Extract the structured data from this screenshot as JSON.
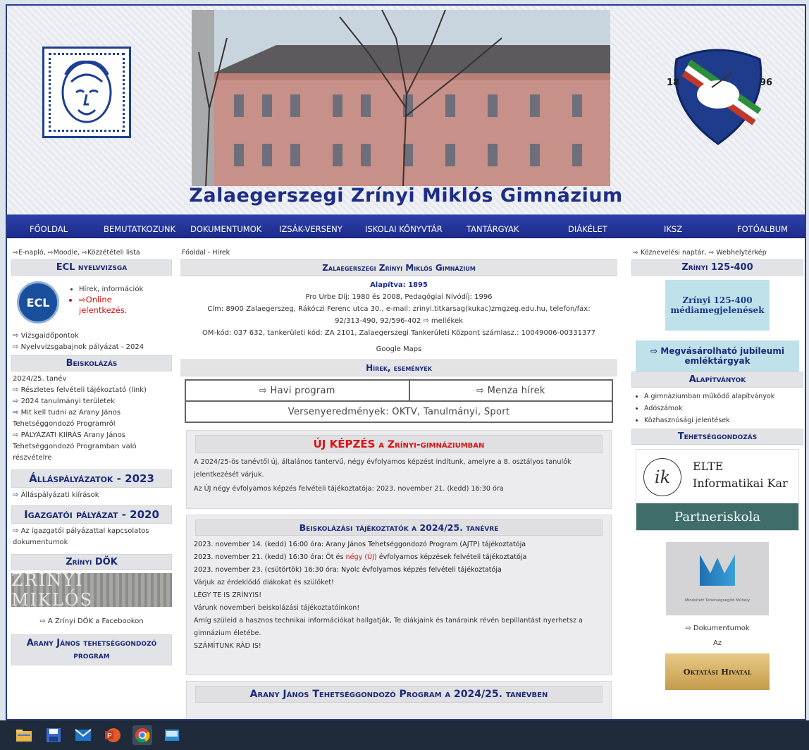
{
  "header": {
    "title": "Zalaegerszegi Zrínyi Miklós Gimnázium",
    "crest_years": [
      "18",
      "96"
    ]
  },
  "nav": {
    "items": [
      "Főoldal",
      "Bemutatkozunk",
      "Dokumentumok",
      "Izsák-verseny",
      "Iskolai könyvtár",
      "Tantárgyak",
      "Diákélet",
      "IKSZ",
      "Fotóalbum"
    ]
  },
  "left": {
    "toplinks": "⇨E-napló, ⇨Moodle, ⇨Közzétételi lista",
    "ecl_title": "ECL nyelvvizsga",
    "ecl_links": [
      "Hírek, információk",
      "⇨Online jelentkezés."
    ],
    "ecl_more": [
      "Vizsgaidőpontok",
      "Nyelvvizsgabajnok pályázat - 2024"
    ],
    "beiskolazas_title": "Beiskolázás",
    "tanev": "2024/25. tanév",
    "beiskolazas_links": [
      "Részletes felvételi tájékoztató (link)",
      "2024 tanulmányi területek",
      "Mit kell tudni az Arany János Tehetséggondozó Programról",
      "PÁLYÁZATI KIÍRÁS Arany János Tehetséggondozó Programban való részvételre"
    ],
    "allas_title": "Álláspályázatok - 2023",
    "allas_link": "Álláspályázati kiírások",
    "igazgatoi_title": "Igazgatói pályázat - 2020",
    "igazgatoi_link": "Az igazgatói pályázattal kapcsolatos dokumentumok",
    "dok_title": "Zrínyi DÖK",
    "dok_image_text": "ZRÍNYI MIKLÓS",
    "dok_link": "⇨ A Zrínyi DÖK a Facebookon",
    "arany_title": "Arany János tehetséggondozó program"
  },
  "mid": {
    "breadcrumb": "Főoldal - Hírek",
    "school_title": "Zalaegerszegi Zrínyi Miklós Gimnázium",
    "alapitva": "Alapítva: 1895",
    "dijak": "Pro Urbe Díj: 1980 és 2008, Pedagógiai Nívódíj: 1996",
    "cim": "Cím: 8900 Zalaegerszeg, Rákóczi Ferenc utca 30., e-mail: zrinyi.titkarsag(kukac)zmgzeg.edu.hu, telefon/fax:",
    "telefon": "92/313-490, 92/596-402",
    "mellekek": "⇨ mellékek",
    "om": "OM-kód: 037 632, tankerületi kód: ZA 2101, Zalaegerszegi Tankerületi Központ számlasz.: 10049006-00331377",
    "maps": "Google Maps",
    "hirek_title": "Hírek, események",
    "havi": "⇨ Havi program",
    "menza": "⇨ Menza hírek",
    "verseny": "Versenyeredmények:  OKTV,  Tanulmányi,  Sport",
    "uj_title_a": "ÚJ KÉPZÉS",
    "uj_title_b": " a Zrínyi-gimnáziumban",
    "uj_p1": "A 2024/25-ös tanévtől új, általános tantervű, négy évfolyamos képzést indítunk, amelyre a 8. osztályos tanulók jelentkezését várjuk.",
    "uj_p2": "Az ÚJ négy évfolyamos képzés felvételi tájékoztatója: 2023. november 21. (kedd) 16:30 óra",
    "bt_title": "Beiskolázási tájékoztatók a 2024/25. tanévre",
    "bt_l1": "2023. november 14. (kedd) 16:00 óra: Arany János Tehetséggondozó Program (AJTP) tájékoztatója",
    "bt_l2a": "2023. november 21. (kedd) 16:30 óra: Öt és ",
    "bt_l2b": "négy (ÚJ)",
    "bt_l2c": " évfolyamos képzések felvételi tájékoztatója",
    "bt_l3": "2023. november 23. (csütörtök) 16:30 óra: Nyolc évfolyamos képzés felvételi tájékoztatója",
    "bt_l4": "Várjuk az érdeklődő diákokat és szülőket!",
    "bt_l5": "LÉGY TE IS ZRÍNYIS!",
    "bt_l6": "Várunk novemberi beiskolázási tájékoztatóinkon!",
    "bt_l7": "Amíg szüleid a hasznos technikai információkat hallgatják, Te diákjaink és tanáraink révén bepillantást nyerhetsz a gimnázium életébe.",
    "bt_l8": "SZÁMÍTUNK RÁD IS!",
    "last_title": "Arany János Tehetséggondozó Program a 2024/25. tanévben"
  },
  "right": {
    "toplinks": "⇨ Köznevelési naptár, ⇨ Webhelytérkép",
    "z125_title": "Zrínyi 125-400",
    "z125_box": "Zrínyi 125-400 médiamegjelenések",
    "jubileumi": "⇨ Megvásárolható jubileumi emléktárgyak",
    "alap_title": "Alapítványok",
    "alap_items": [
      "A gimnáziumban működő alapítványok",
      "Adószámok",
      "Közhasznúsági jelentések"
    ],
    "teh_title": "Tehetséggondozás",
    "elte_line1": "ELTE",
    "elte_line2": "Informatikai Kar",
    "elte_partner": "Partneriskola",
    "mm_caption": "Minősített Tehetségsegítő Műhely",
    "mm_link": "⇨ Dokumentumok",
    "az": "Az",
    "oh": "Oktatási Hivatal"
  },
  "colors": {
    "brand_blue": "#23349b",
    "title_blue": "#1e2e86",
    "accent_red": "#d11",
    "partner_teal": "#3f6e6a"
  }
}
